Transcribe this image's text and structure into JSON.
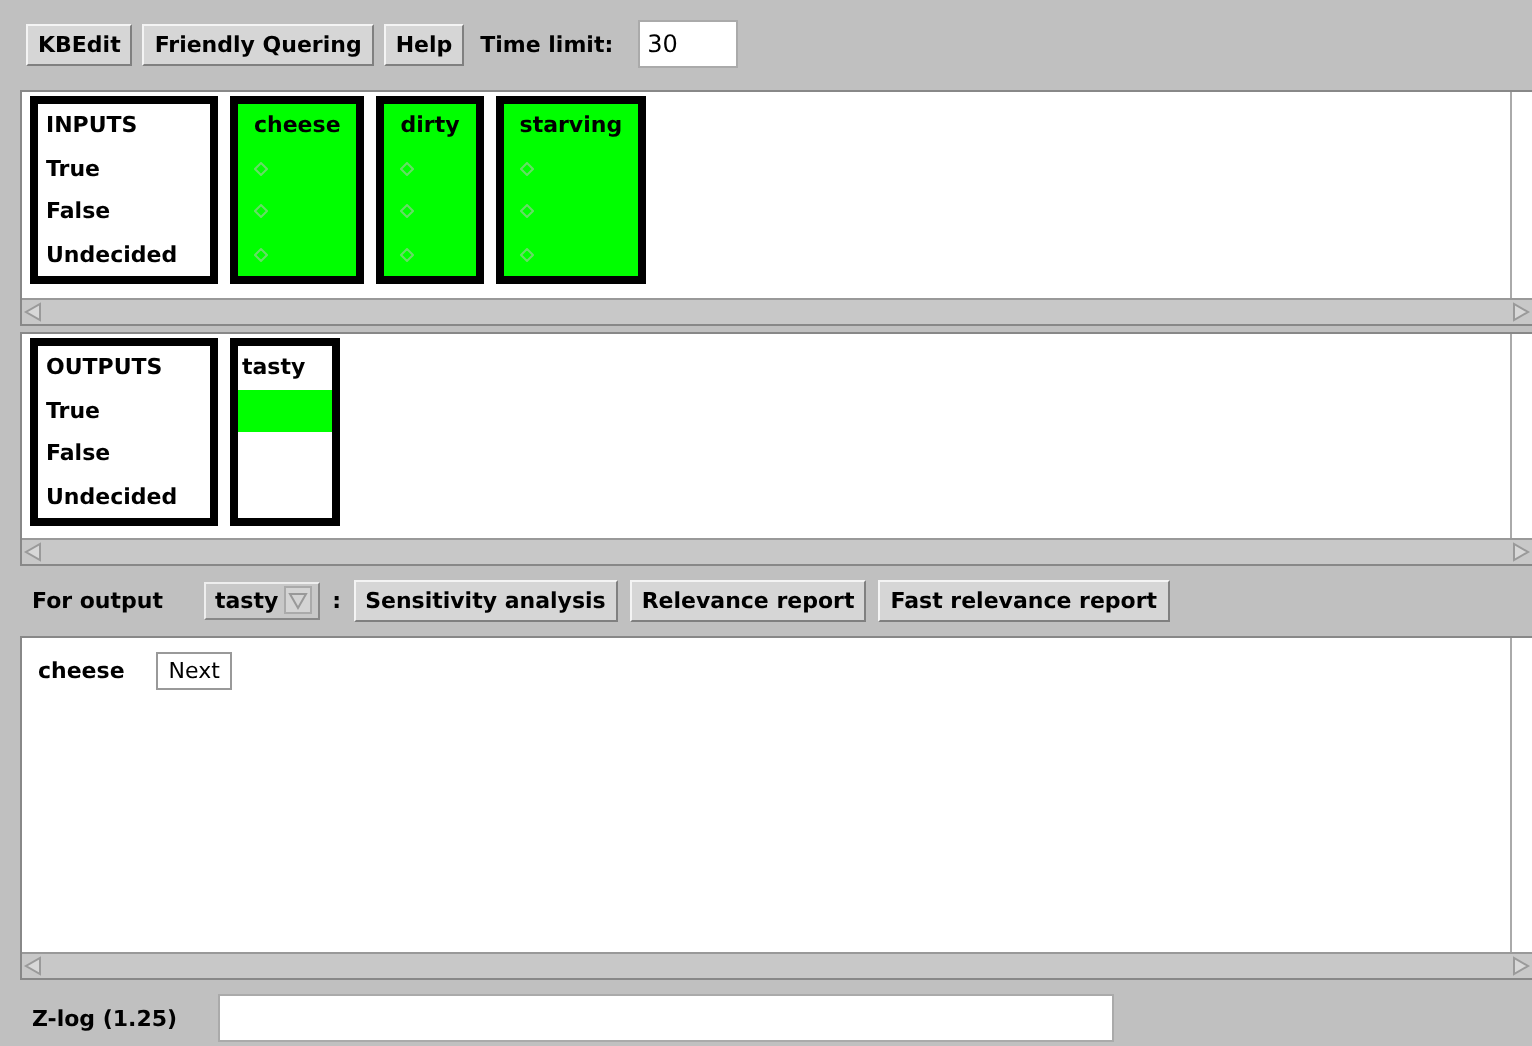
{
  "toolbar": {
    "buttons": [
      "KBEdit",
      "Friendly Quering",
      "Help"
    ],
    "time_limit": {
      "label": "Time limit:",
      "value": "30"
    }
  },
  "inputs": {
    "header": {
      "title": "INPUTS",
      "rows": [
        "True",
        "False",
        "Undecided"
      ]
    },
    "variables": [
      {
        "name": "cheese",
        "highlighted": true
      },
      {
        "name": "dirty",
        "highlighted": true
      },
      {
        "name": "starving",
        "highlighted": true
      }
    ]
  },
  "outputs": {
    "header": {
      "title": "OUTPUTS",
      "rows": [
        "True",
        "False",
        "Undecided"
      ]
    },
    "variables": [
      {
        "name": "tasty",
        "states": [
          {
            "selected": true
          },
          {
            "selected": false
          },
          {
            "selected": false
          }
        ]
      }
    ]
  },
  "analysis_bar": {
    "label": "For output",
    "dropdown": "tasty",
    "separator": ":",
    "buttons": [
      "Sensitivity analysis",
      "Relevance report",
      "Fast relevance report"
    ]
  },
  "report": {
    "item": "cheese",
    "button": "Next"
  },
  "zlog": {
    "label": "Z-log (1.25)"
  }
}
